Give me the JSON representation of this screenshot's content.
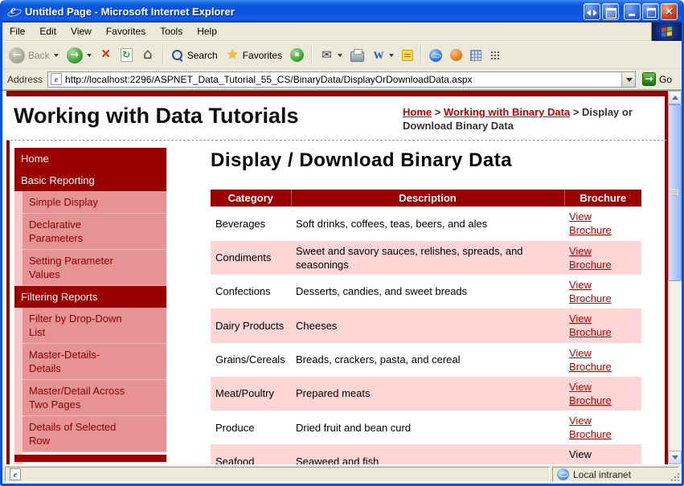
{
  "colors": {
    "maroon": "#990000",
    "row_pink": "#ffd6d6",
    "sidebar_pink": "#e69393",
    "sidebar_strip": "#f5c9c9",
    "link_red": "#c00000",
    "xp_title_blue": "#0b54dd",
    "chrome_beige": "#ece9d8"
  },
  "icons": {
    "app": "ie-logo-e",
    "back": "gray-circle-left-arrow",
    "forward": "green-circle-right-arrow",
    "stop": "red-x",
    "refresh": "page-with-green-arrows",
    "home": "house",
    "search": "magnifier",
    "favorites": "gold-star",
    "go": "green-square-right-arrow",
    "status_zone": "globe"
  },
  "window": {
    "title": "Untitled Page - Microsoft Internet Explorer"
  },
  "menu": {
    "items": [
      "File",
      "Edit",
      "View",
      "Favorites",
      "Tools",
      "Help"
    ]
  },
  "toolbar": {
    "back_label": "Back",
    "search_label": "Search",
    "favorites_label": "Favorites"
  },
  "address": {
    "label": "Address",
    "value": "http://localhost:2296/ASPNET_Data_Tutorial_55_CS/BinaryData/DisplayOrDownloadData.aspx",
    "go_label": "Go"
  },
  "page": {
    "site_title": "Working with Data Tutorials",
    "breadcrumb": {
      "home": "Home",
      "separator": ">",
      "section": "Working with Binary Data",
      "current": "Display or Download Binary Data"
    },
    "heading": "Display / Download Binary Data",
    "sidebar": {
      "items": [
        {
          "label": "Home",
          "type": "top"
        },
        {
          "label": "Basic Reporting",
          "type": "top"
        },
        {
          "label": "Simple Display",
          "type": "sub"
        },
        {
          "label": "Declarative Parameters",
          "type": "sub"
        },
        {
          "label": "Setting Parameter Values",
          "type": "sub"
        },
        {
          "label": "Filtering Reports",
          "type": "top"
        },
        {
          "label": "Filter by Drop-Down List",
          "type": "sub"
        },
        {
          "label": "Master-Details-Details",
          "type": "sub"
        },
        {
          "label": "Master/Detail Across Two Pages",
          "type": "sub"
        },
        {
          "label": "Details of Selected Row",
          "type": "sub"
        }
      ]
    },
    "table": {
      "headers": [
        "Category",
        "Description",
        "Brochure"
      ],
      "rows": [
        {
          "category": "Beverages",
          "description": "Soft drinks, coffees, teas, beers, and ales",
          "brochure": "View Brochure",
          "is_link": true
        },
        {
          "category": "Condiments",
          "description": "Sweet and savory sauces, relishes, spreads, and seasonings",
          "brochure": "View Brochure",
          "is_link": true
        },
        {
          "category": "Confections",
          "description": "Desserts, candies, and sweet breads",
          "brochure": "View Brochure",
          "is_link": true
        },
        {
          "category": "Dairy Products",
          "description": "Cheeses",
          "brochure": "View Brochure",
          "is_link": true
        },
        {
          "category": "Grains/Cereals",
          "description": "Breads, crackers, pasta, and cereal",
          "brochure": "View Brochure",
          "is_link": true
        },
        {
          "category": "Meat/Poultry",
          "description": "Prepared meats",
          "brochure": "View Brochure",
          "is_link": true
        },
        {
          "category": "Produce",
          "description": "Dried fruit and bean curd",
          "brochure": "View Brochure",
          "is_link": true
        },
        {
          "category": "Seafood",
          "description": "Seaweed and fish",
          "brochure": "View Brochure",
          "is_link": false
        }
      ]
    }
  },
  "status": {
    "zone": "Local intranet"
  }
}
